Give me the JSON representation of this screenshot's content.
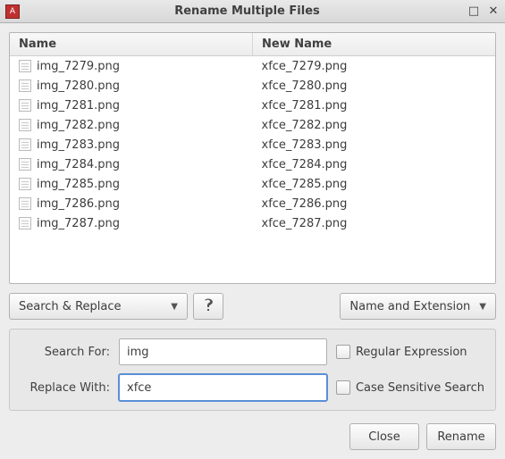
{
  "window": {
    "title": "Rename Multiple Files"
  },
  "columns": {
    "name": "Name",
    "newname": "New Name"
  },
  "files": [
    {
      "name": "img_7279.png",
      "newname": "xfce_7279.png"
    },
    {
      "name": "img_7280.png",
      "newname": "xfce_7280.png"
    },
    {
      "name": "img_7281.png",
      "newname": "xfce_7281.png"
    },
    {
      "name": "img_7282.png",
      "newname": "xfce_7282.png"
    },
    {
      "name": "img_7283.png",
      "newname": "xfce_7283.png"
    },
    {
      "name": "img_7284.png",
      "newname": "xfce_7284.png"
    },
    {
      "name": "img_7285.png",
      "newname": "xfce_7285.png"
    },
    {
      "name": "img_7286.png",
      "newname": "xfce_7286.png"
    },
    {
      "name": "img_7287.png",
      "newname": "xfce_7287.png"
    }
  ],
  "mode": {
    "selected": "Search & Replace"
  },
  "scope": {
    "selected": "Name and Extension"
  },
  "params": {
    "search_label": "Search For:",
    "search_value": "img",
    "replace_label": "Replace With:",
    "replace_value": "xfce",
    "regex_label": "Regular Expression",
    "case_label": "Case Sensitive Search"
  },
  "buttons": {
    "close": "Close",
    "rename": "Rename"
  }
}
